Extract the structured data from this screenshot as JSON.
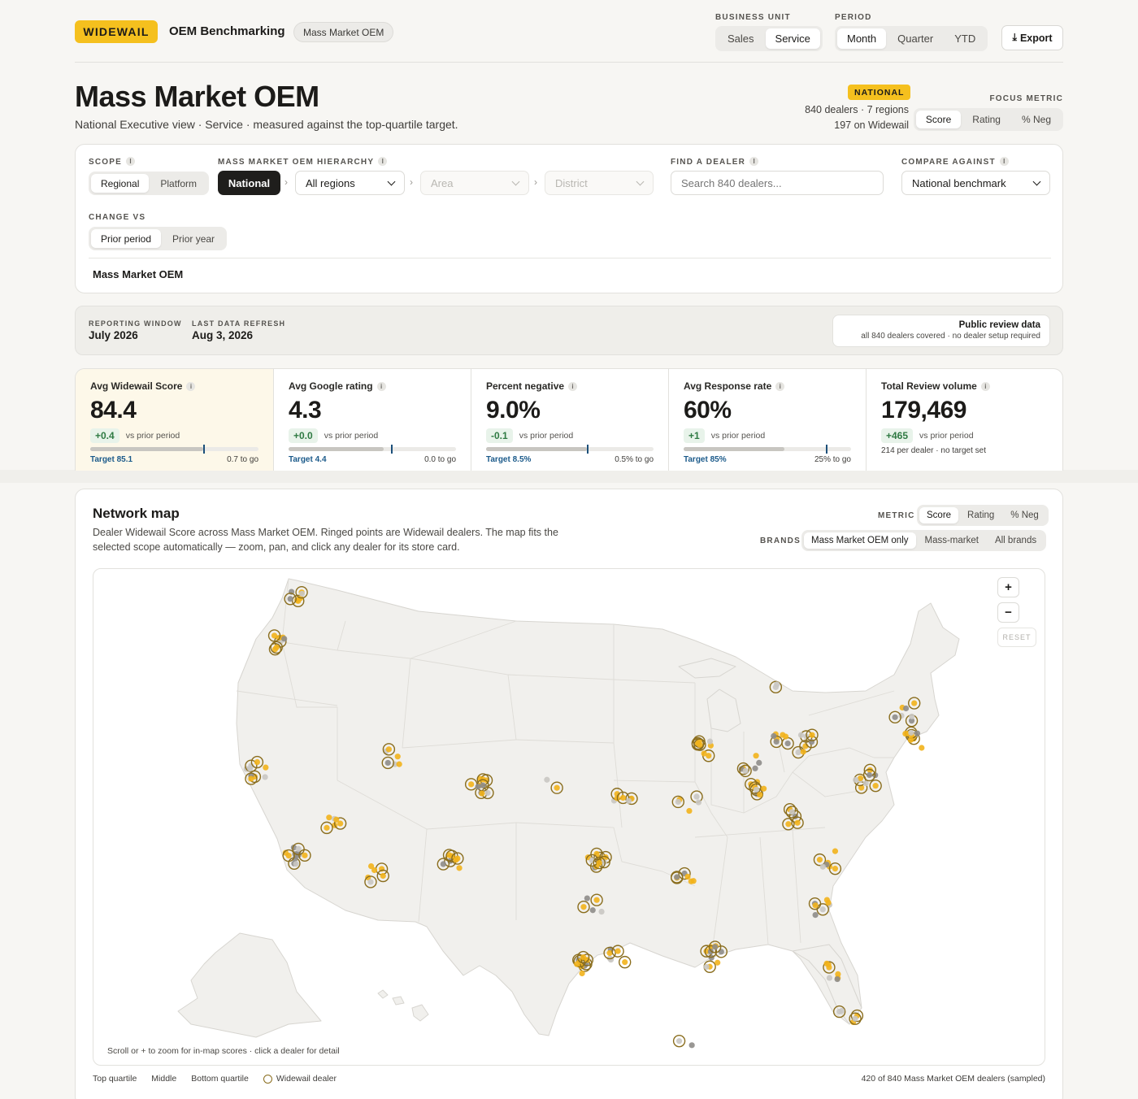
{
  "header": {
    "logo": "WIDEWAIL",
    "app_title": "OEM Benchmarking",
    "brand_tag": "Mass Market OEM",
    "business_unit_label": "BUSINESS UNIT",
    "business_units": [
      "Sales",
      "Service"
    ],
    "business_unit_selected": "Service",
    "period_label": "PERIOD",
    "periods": [
      "Month",
      "Quarter",
      "YTD"
    ],
    "period_selected": "Month",
    "export_label": "Export"
  },
  "title_block": {
    "title": "Mass Market OEM",
    "subtitle": "National Executive view · Service · measured against the top-quartile target.",
    "badge": "NATIONAL",
    "dealers_line": "840 dealers · 7 regions",
    "widewail_line": "197 on Widewail",
    "focus_metric_label": "FOCUS METRIC",
    "focus_metrics": [
      "Score",
      "Rating",
      "% Neg"
    ],
    "focus_selected": "Score"
  },
  "filters": {
    "scope_label": "SCOPE",
    "scope_options": [
      "Regional",
      "Platform"
    ],
    "hierarchy_label": "MASS MARKET OEM HIERARCHY",
    "hierarchy_national": "National",
    "region_select": "All regions",
    "area_placeholder": "Area",
    "district_placeholder": "District",
    "find_label": "FIND A DEALER",
    "search_placeholder": "Search 840 dealers...",
    "compare_label": "COMPARE AGAINST",
    "compare_value": "National benchmark",
    "change_label": "CHANGE VS",
    "change_options": [
      "Prior period",
      "Prior year"
    ],
    "breadcrumb": "Mass Market OEM"
  },
  "reporting": {
    "window_label": "REPORTING WINDOW",
    "window_value": "July 2026",
    "refresh_label": "LAST DATA REFRESH",
    "refresh_value": "Aug 3, 2026",
    "source_title": "Public review data",
    "source_sub": "all 840 dealers covered · no dealer setup required"
  },
  "kpis": [
    {
      "label": "Avg Widewail Score",
      "value": "84.4",
      "delta": "+0.4",
      "delta_note": "vs prior period",
      "target": "Target 85.1",
      "to_go": "0.7 to go",
      "fill": 0.67,
      "marker": 0.67
    },
    {
      "label": "Avg Google rating",
      "value": "4.3",
      "delta": "+0.0",
      "delta_note": "vs prior period",
      "target": "Target 4.4",
      "to_go": "0.0 to go",
      "fill": 0.57,
      "marker": 0.61
    },
    {
      "label": "Percent negative",
      "value": "9.0%",
      "delta": "-0.1",
      "delta_note": "vs prior period",
      "target": "Target 8.5%",
      "to_go": "0.5% to go",
      "fill": 0.6,
      "marker": 0.6
    },
    {
      "label": "Avg Response rate",
      "value": "60%",
      "delta": "+1",
      "delta_note": "vs prior period",
      "target": "Target 85%",
      "to_go": "25% to go",
      "fill": 0.6,
      "marker": 0.85
    },
    {
      "label": "Total Review volume",
      "value": "179,469",
      "delta": "+465",
      "delta_note": "vs prior period",
      "note": "214 per dealer · no target set"
    }
  ],
  "network_map": {
    "title": "Network map",
    "description": "Dealer Widewail Score across Mass Market OEM. Ringed points are Widewail dealers. The map fits the selected scope automatically — zoom, pan, and click any dealer for its store card.",
    "metric_label": "METRIC",
    "metrics": [
      "Score",
      "Rating",
      "% Neg"
    ],
    "metric_selected": "Score",
    "brands_label": "BRANDS",
    "brands": [
      "Mass Market OEM only",
      "Mass-market",
      "All brands"
    ],
    "brand_selected": "Mass Market OEM only",
    "zoom_in": "+",
    "zoom_out": "−",
    "reset": "RESET",
    "hint": "Scroll or + to zoom for in-map scores · click a dealer for detail",
    "legend": [
      "Top quartile",
      "Middle",
      "Bottom quartile",
      "Widewail dealer"
    ],
    "sample_note": "420 of 840 Mass Market OEM dealers (sampled)",
    "colors": {
      "top": "#f2b21b",
      "middle": "#c9c7c2",
      "bottom": "#8e8c88",
      "ring": "#8a6d1d"
    }
  }
}
